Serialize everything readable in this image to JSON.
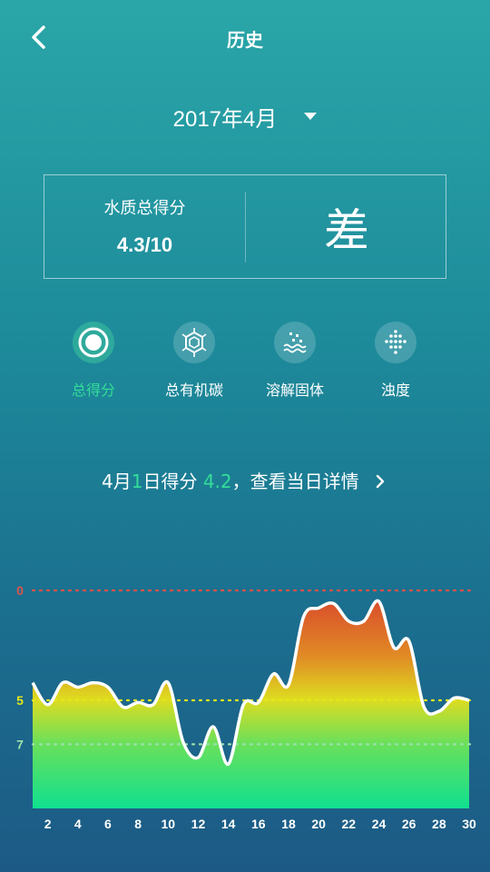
{
  "header": {
    "title": "历史",
    "back_icon": "chevron-left-icon"
  },
  "month_selector": {
    "value": "2017年4月",
    "icon": "caret-down-icon"
  },
  "score_card": {
    "label": "水质总得分",
    "value": "4.3/10",
    "grade": "差"
  },
  "tabs": [
    {
      "label": "总得分",
      "icon": "ring-dot-icon",
      "active": true
    },
    {
      "label": "总有机碳",
      "icon": "molecule-icon",
      "active": false
    },
    {
      "label": "溶解固体",
      "icon": "dissolved-solids-icon",
      "active": false
    },
    {
      "label": "浊度",
      "icon": "dots-grid-icon",
      "active": false
    }
  ],
  "day_detail": {
    "prefix": "4月",
    "day": "1",
    "mid": "日得分 ",
    "score": "4.2",
    "suffix": "，查看当日详情",
    "icon": "chevron-right-icon"
  },
  "colors": {
    "accent": "#33dd99",
    "ref_zero": "#e0534a",
    "ref_five": "#e6e619",
    "ref_seven": "#9be0a8"
  },
  "chart_data": {
    "type": "area",
    "x": [
      1,
      2,
      3,
      4,
      5,
      6,
      7,
      8,
      9,
      10,
      11,
      12,
      13,
      14,
      15,
      16,
      17,
      18,
      19,
      20,
      21,
      22,
      23,
      24,
      25,
      26,
      27,
      28,
      29,
      30
    ],
    "values": [
      4.2,
      5.2,
      4.2,
      4.4,
      4.2,
      4.4,
      5.3,
      5.1,
      5.2,
      4.2,
      6.9,
      7.6,
      6.2,
      7.9,
      5.2,
      5.1,
      3.8,
      4.3,
      1.2,
      0.8,
      0.6,
      1.4,
      1.4,
      0.5,
      2.6,
      2.3,
      5.3,
      5.5,
      4.9,
      5.0
    ],
    "x_ticks": [
      "2",
      "4",
      "6",
      "8",
      "10",
      "12",
      "14",
      "16",
      "18",
      "20",
      "22",
      "24",
      "26",
      "28",
      "30"
    ],
    "reference_lines": [
      {
        "value": 0,
        "label": "0"
      },
      {
        "value": 5,
        "label": "5"
      },
      {
        "value": 7,
        "label": "7"
      }
    ],
    "y_axis": "inverted",
    "grid": false
  }
}
